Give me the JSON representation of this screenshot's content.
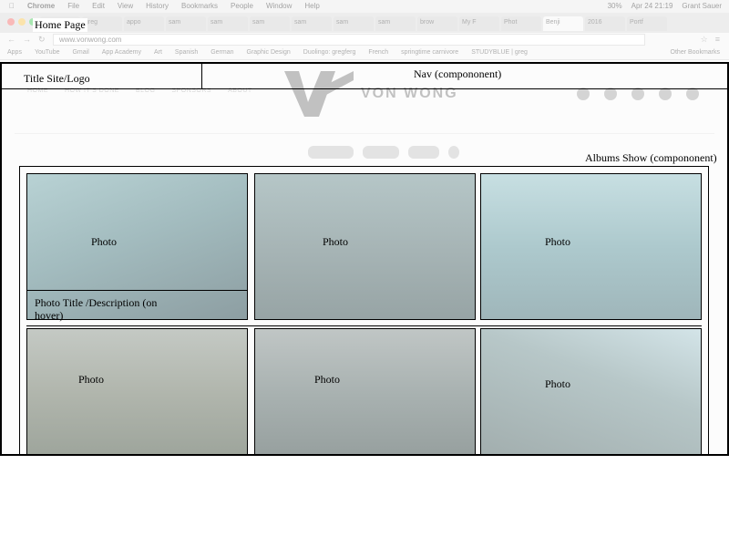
{
  "browser": {
    "mac_menu": [
      "Chrome",
      "File",
      "Edit",
      "View",
      "History",
      "Bookmarks",
      "People",
      "Window",
      "Help"
    ],
    "status": {
      "battery": "30%",
      "datetime": "Apr 24  21:19",
      "user": "Grant Sauer"
    },
    "tabs": [
      "caps",
      "greg",
      "appo",
      "sam",
      "sam",
      "sam",
      "sam",
      "sam",
      "sam",
      "brow",
      "My F",
      "Phot",
      "Benji",
      "2016",
      "Portf"
    ],
    "url": "www.vonwong.com",
    "bookmarks": [
      "Apps",
      "YouTube",
      "Gmail",
      "App Academy",
      "Art",
      "Spanish",
      "German",
      "Graphic Design",
      "Duolingo: gregferg",
      "French",
      "springtime carnivore",
      "STUDYBLUE | greg"
    ],
    "other_bookmarks": "Other Bookmarks"
  },
  "site": {
    "nav_items": [
      "HOME",
      "HOW IT'S DONE",
      "BLOG",
      "SPONSORS",
      "ABOUT"
    ],
    "logo_text": "VON WONG"
  },
  "wireframe": {
    "page_label": "Home Page",
    "logo_label": "Title Site/Logo",
    "nav_label": "Nav (compоnonent)",
    "albums_label": "Albums Show (compоnonent)",
    "photo_label": "Photo",
    "caption_label_line1": "Photo Title /Description (on",
    "caption_label_line2": "hover)"
  },
  "photos": [
    {
      "label": "Photo"
    },
    {
      "label": "Photo"
    },
    {
      "label": "Photo"
    },
    {
      "label": "Photo"
    },
    {
      "label": "Photo"
    },
    {
      "label": "Photo"
    }
  ],
  "colors": {
    "wireframe_line": "#000000",
    "underwater_blue": "#3f6f74"
  }
}
